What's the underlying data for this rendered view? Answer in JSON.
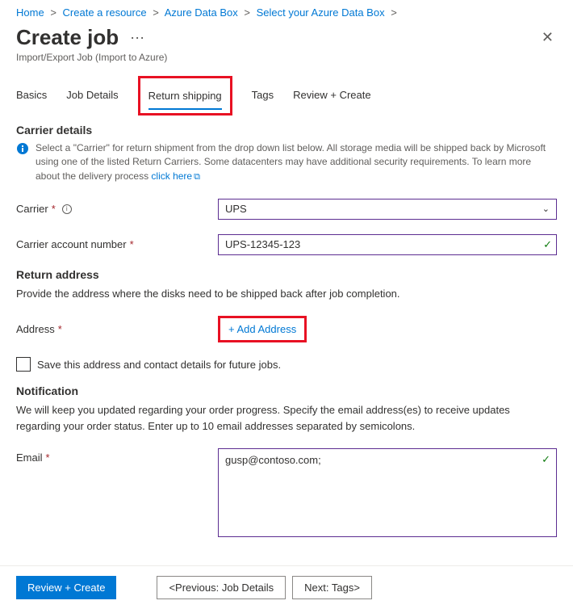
{
  "breadcrumb": {
    "items": [
      "Home",
      "Create a resource",
      "Azure Data Box",
      "Select your Azure Data Box"
    ]
  },
  "header": {
    "title": "Create job",
    "subtitle": "Import/Export Job (Import to Azure)"
  },
  "tabs": {
    "items": [
      {
        "label": "Basics"
      },
      {
        "label": "Job Details"
      },
      {
        "label": "Return shipping"
      },
      {
        "label": "Tags"
      },
      {
        "label": "Review + Create"
      }
    ],
    "active_index": 2
  },
  "carrier_section": {
    "title": "Carrier details",
    "info_text": "Select a \"Carrier\" for return shipment from the drop down list below. All storage media will be shipped back by Microsoft using one of the listed Return Carriers. Some datacenters may have additional security requirements. To learn more about the delivery process ",
    "info_link": "click here",
    "carrier_label": "Carrier",
    "carrier_value": "UPS",
    "account_label": "Carrier account number",
    "account_value": "UPS-12345-123"
  },
  "return_section": {
    "title": "Return address",
    "desc": "Provide the address where the disks need to be shipped back after job completion.",
    "address_label": "Address",
    "add_link": "+ Add Address",
    "save_label": "Save this address and contact details for future jobs."
  },
  "notification_section": {
    "title": "Notification",
    "desc": "We will keep you updated regarding your order progress. Specify the email address(es) to receive updates regarding your order status. Enter up to 10 email addresses separated by semicolons.",
    "email_label": "Email",
    "email_value": "gusp@contoso.com;"
  },
  "footer": {
    "review": "Review + Create",
    "prev": "<Previous: Job Details",
    "next": "Next: Tags>"
  }
}
